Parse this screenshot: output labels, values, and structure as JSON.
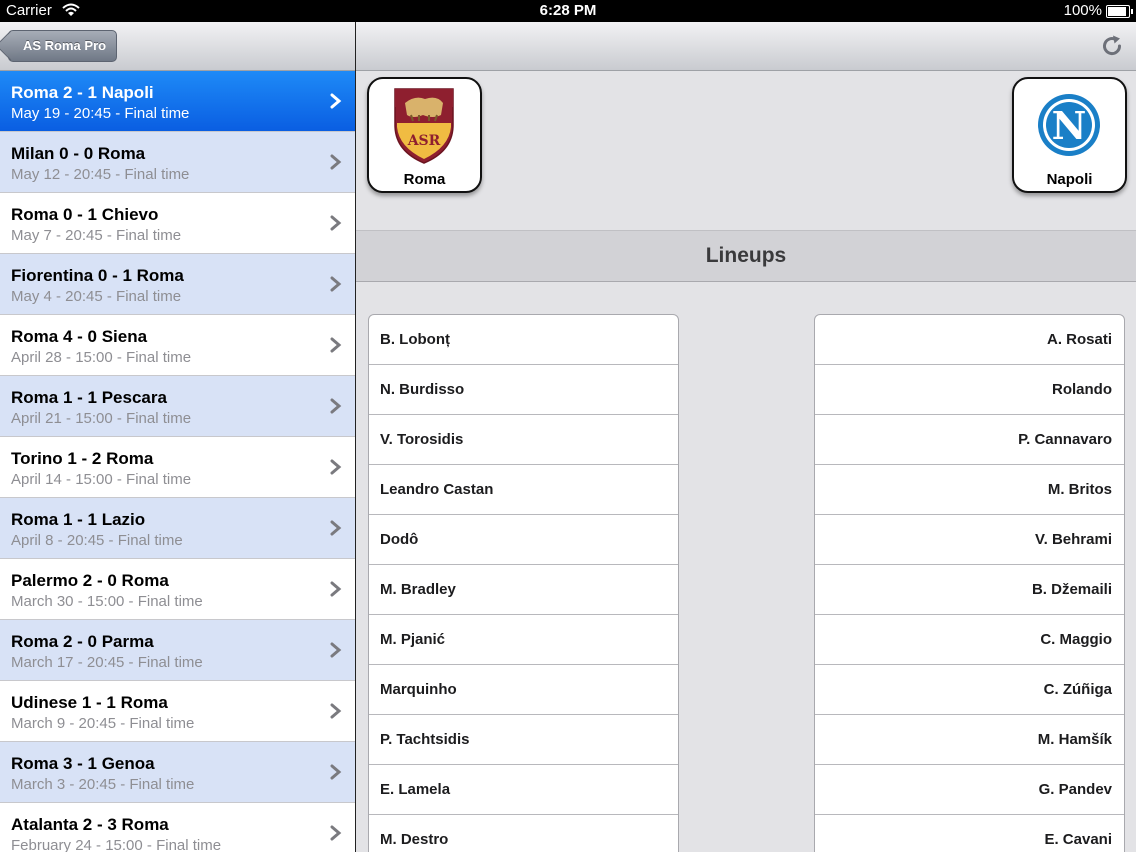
{
  "status_bar": {
    "carrier": "Carrier",
    "time": "6:28 PM",
    "battery": "100%"
  },
  "left_nav": {
    "back_label": "AS Roma Pro"
  },
  "matches": [
    {
      "title": "Roma 2 - 1 Napoli",
      "subtitle": "May 19 - 20:45 - Final time",
      "selected": true
    },
    {
      "title": "Milan 0 - 0 Roma",
      "subtitle": "May 12 - 20:45 - Final time"
    },
    {
      "title": "Roma 0 - 1 Chievo",
      "subtitle": "May 7 - 20:45 - Final time"
    },
    {
      "title": "Fiorentina 0 - 1 Roma",
      "subtitle": "May 4 - 20:45 - Final time"
    },
    {
      "title": "Roma 4 - 0 Siena",
      "subtitle": "April 28 - 15:00 - Final time"
    },
    {
      "title": "Roma 1 - 1 Pescara",
      "subtitle": "April 21 - 15:00 - Final time"
    },
    {
      "title": "Torino 1 - 2 Roma",
      "subtitle": "April 14 - 15:00 - Final time"
    },
    {
      "title": "Roma 1 - 1 Lazio",
      "subtitle": "April 8 - 20:45 - Final time"
    },
    {
      "title": "Palermo 2 - 0 Roma",
      "subtitle": "March 30 - 15:00 - Final time"
    },
    {
      "title": "Roma 2 - 0 Parma",
      "subtitle": "March 17 - 20:45 - Final time"
    },
    {
      "title": "Udinese 1 - 1 Roma",
      "subtitle": "March 9 - 20:45 - Final time"
    },
    {
      "title": "Roma 3 - 1 Genoa",
      "subtitle": "March 3 - 20:45 - Final time"
    },
    {
      "title": "Atalanta 2 - 3 Roma",
      "subtitle": "February 24 - 15:00 - Final time"
    }
  ],
  "detail": {
    "home_team": "Roma",
    "away_team": "Napoli",
    "section_title": "Lineups",
    "home_lineup": [
      "B. Lobonț",
      "N. Burdisso",
      "V. Torosidis",
      "Leandro Castan",
      "Dodô",
      "M. Bradley",
      "M. Pjanić",
      "Marquinho",
      "P. Tachtsidis",
      "E. Lamela",
      "M. Destro"
    ],
    "away_lineup": [
      "A. Rosati",
      "Rolando",
      "P. Cannavaro",
      "M. Britos",
      "V. Behrami",
      "B. Džemaili",
      "C. Maggio",
      "C. Zúñiga",
      "M. Hamšík",
      "G. Pandev",
      "E. Cavani"
    ]
  },
  "colors": {
    "selected_row": "#0a5ee2",
    "alt_row": "#d8e2f6",
    "roma_red": "#8e1f2f",
    "roma_yellow": "#f0bc42",
    "napoli_blue": "#1a7fc7"
  },
  "icons": {
    "back": "back-arrow-icon",
    "refresh": "refresh-icon",
    "row": "chevron-right-icon"
  }
}
